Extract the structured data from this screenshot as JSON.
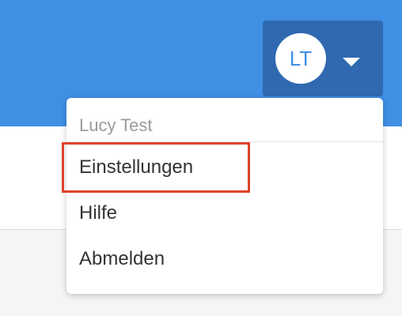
{
  "header": {
    "user_initials": "LT"
  },
  "user_menu": {
    "username": "Lucy Test",
    "items": [
      {
        "label": "Einstellungen"
      },
      {
        "label": "Hilfe"
      },
      {
        "label": "Abmelden"
      }
    ]
  },
  "colors": {
    "topbar": "#3f8fe4",
    "user_button": "#3069b0",
    "highlight": "#e0422c"
  }
}
